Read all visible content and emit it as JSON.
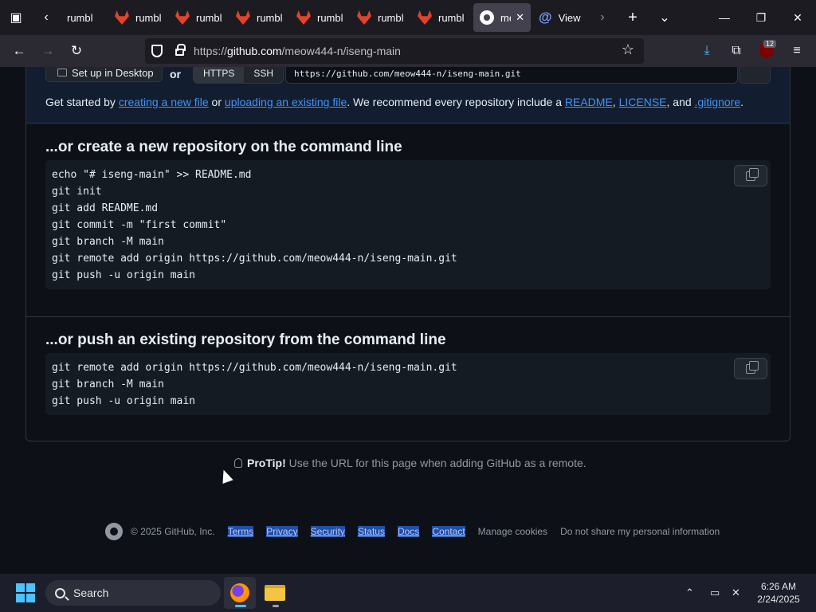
{
  "browser": {
    "tabs": [
      {
        "label": "rumbl",
        "icon": "gitlab-icon"
      },
      {
        "label": "rumbl",
        "icon": "gitlab-icon"
      },
      {
        "label": "rumbl",
        "icon": "gitlab-icon"
      },
      {
        "label": "rumbl",
        "icon": "gitlab-icon"
      },
      {
        "label": "rumbl",
        "icon": "gitlab-icon"
      },
      {
        "label": "rumbl",
        "icon": "gitlab-icon"
      },
      {
        "label": "rumbl",
        "icon": "gitlab-icon"
      }
    ],
    "active_tab": {
      "label": "me",
      "icon": "github-icon"
    },
    "next_tab": {
      "label": "View r",
      "icon": "at-icon"
    },
    "url_prefix": "https://",
    "url_host": "github.com",
    "url_path": "/meow444-n/iseng-main",
    "extension_badge": "12"
  },
  "quick_setup": {
    "desktop_button": "Set up in Desktop",
    "or_label": "or",
    "protocols": [
      "HTTPS",
      "SSH"
    ],
    "clone_url": "https://github.com/meow444-n/iseng-main.git",
    "get_started_prefix": "Get started by ",
    "link_new_file": "creating a new file",
    "or_text": " or ",
    "link_upload": "uploading an existing file",
    "recommend_text": ". We recommend every repository include a ",
    "link_readme": "README",
    "comma": ", ",
    "link_license": "LICENSE",
    "and_text": ", and ",
    "link_gitignore": ".gitignore",
    "period": "."
  },
  "new_repo": {
    "title": "...or create a new repository on the command line",
    "lines": [
      "echo \"# iseng-main\" >> README.md",
      "git init",
      "git add README.md",
      "git commit -m \"first commit\"",
      "git branch -M main",
      "git remote add origin https://github.com/meow444-n/iseng-main.git",
      "git push -u origin main"
    ]
  },
  "push_existing": {
    "title": "...or push an existing repository from the command line",
    "lines": [
      "git remote add origin https://github.com/meow444-n/iseng-main.git",
      "git branch -M main",
      "git push -u origin main"
    ]
  },
  "protip": {
    "label": "ProTip!",
    "text": " Use the URL for this page when adding GitHub as a remote."
  },
  "footer": {
    "copyright": "© 2025 GitHub, Inc.",
    "links": [
      "Terms",
      "Privacy",
      "Security",
      "Status",
      "Docs",
      "Contact"
    ],
    "manage_cookies": "Manage cookies",
    "do_not_share": "Do not share my personal information"
  },
  "taskbar": {
    "search_label": "Search",
    "time": "6:26 AM",
    "date": "2/24/2025"
  }
}
